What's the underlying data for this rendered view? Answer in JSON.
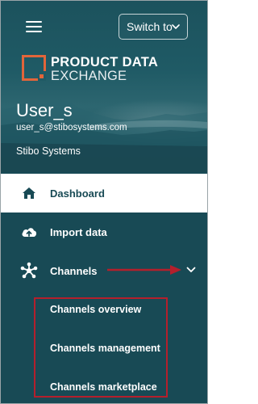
{
  "header": {
    "switch_label": "Switch to",
    "logo_line1": "PRODUCT DATA",
    "logo_line2": "EXCHANGE",
    "user_name": "User_s",
    "user_email": "user_s@stibosystems.com",
    "org_name": "Stibo Systems"
  },
  "nav": {
    "items": [
      {
        "label": "Dashboard",
        "icon": "home-icon",
        "active": true
      },
      {
        "label": "Import data",
        "icon": "cloud-upload-icon",
        "active": false
      },
      {
        "label": "Channels",
        "icon": "channels-network-icon",
        "active": false,
        "expanded": true
      }
    ],
    "channels_sub": [
      {
        "label": "Channels overview"
      },
      {
        "label": "Channels management"
      },
      {
        "label": "Channels marketplace"
      }
    ]
  },
  "annotations": {
    "highlight_color": "#b41f2c"
  },
  "colors": {
    "sidebar_bg": "#184a55",
    "accent_logo": "#e2653a",
    "active_bg": "#ffffff"
  }
}
